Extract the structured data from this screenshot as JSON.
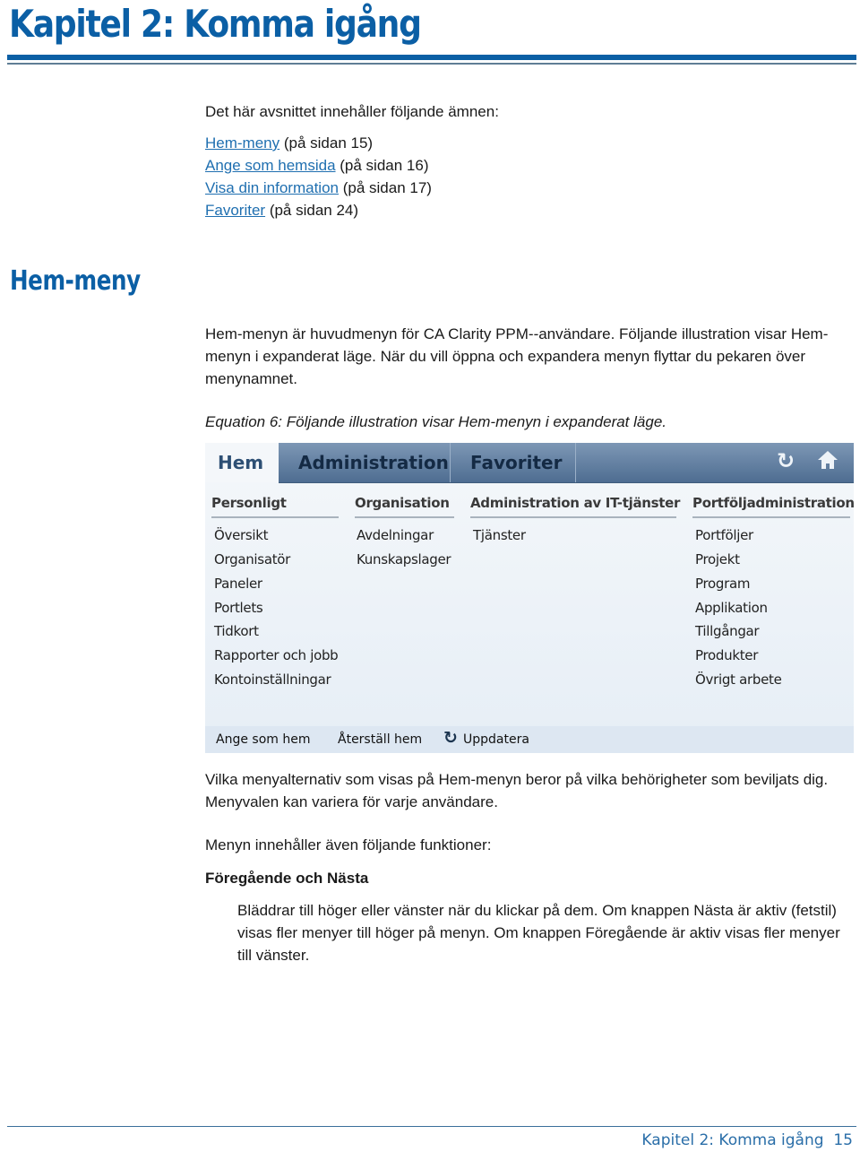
{
  "chapter_title": "Kapitel 2: Komma igång",
  "intro": "Det här avsnittet innehåller följande ämnen:",
  "toc": [
    {
      "link": "Hem-meny",
      "page": "(på sidan 15)"
    },
    {
      "link": "Ange som hemsida",
      "page": "(på sidan 16)"
    },
    {
      "link": "Visa din information",
      "page": "(på sidan 17)"
    },
    {
      "link": "Favoriter",
      "page": "(på sidan 24)"
    }
  ],
  "section_title": "Hem-meny",
  "para1": "Hem-menyn är huvudmenyn för CA Clarity PPM--användare. Följande illustration visar Hem-menyn i expanderat läge. När du vill öppna och expandera menyn flyttar du pekaren över menynamnet.",
  "caption": "Equation 6: Följande illustration visar Hem-menyn i expanderat läge.",
  "menu": {
    "tabs": [
      "Hem",
      "Administration",
      "Favoriter"
    ],
    "icons": [
      "refresh-icon",
      "home-icon"
    ],
    "columns": [
      {
        "heading": "Personligt",
        "items": [
          "Översikt",
          "Organisatör",
          "Paneler",
          "Portlets",
          "Tidkort",
          "Rapporter och jobb",
          "Kontoinställningar"
        ]
      },
      {
        "heading": "Organisation",
        "items": [
          "Avdelningar",
          "Kunskapslager"
        ]
      },
      {
        "heading": "Administration av IT-tjänster",
        "items": [
          "Tjänster"
        ]
      },
      {
        "heading": "Portföljadministration",
        "items": [
          "Portföljer",
          "Projekt",
          "Program",
          "Applikation",
          "Tillgångar",
          "Produkter",
          "Övrigt arbete"
        ]
      }
    ],
    "bottom_links": [
      "Ange som hem",
      "Återställ hem",
      "Uppdatera"
    ]
  },
  "para2": "Vilka menyalternativ som visas på Hem-menyn beror på vilka behörigheter som beviljats dig. Menyvalen kan variera för varje användare.",
  "para3": "Menyn innehåller även följande funktioner:",
  "term": "Föregående och Nästa",
  "para4": "Bläddrar till höger eller vänster när du klickar på dem. Om knappen Nästa är aktiv (fetstil) visas fler menyer till höger på menyn. Om knappen Föregående är aktiv visas fler menyer till vänster.",
  "footer": {
    "chapter": "Kapitel 2: Komma igång",
    "page": "15"
  },
  "colors": {
    "brand": "#0b5fa5",
    "link": "#1f6fb0",
    "menu_bar": "#4e6d91"
  }
}
